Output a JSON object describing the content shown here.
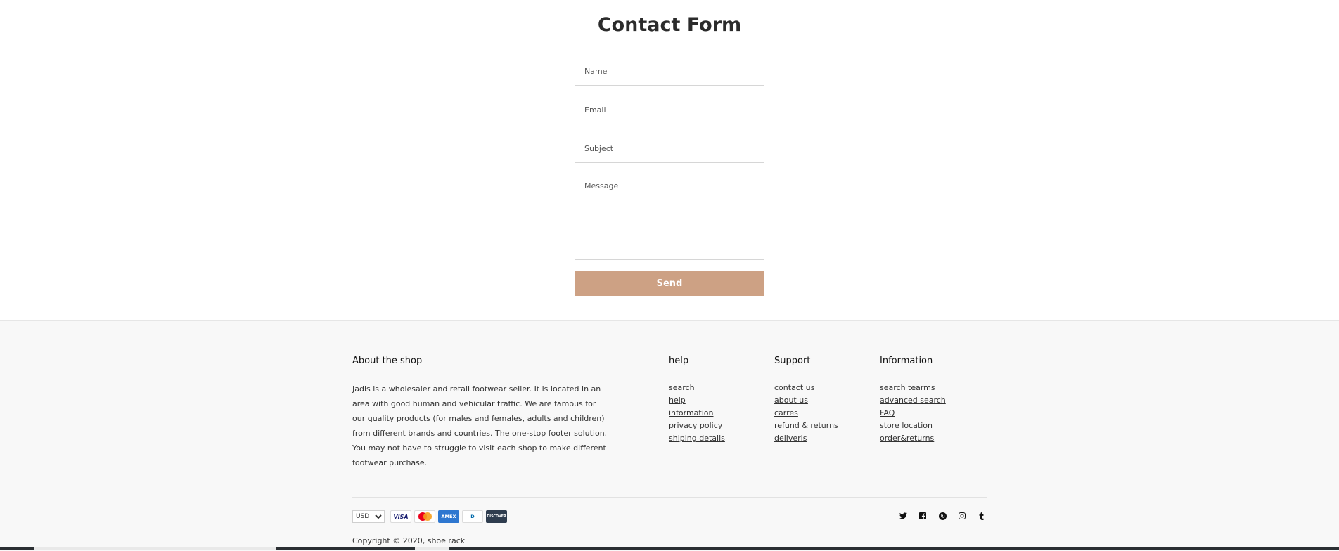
{
  "contact": {
    "title": "Contact Form",
    "name_placeholder": "Name",
    "email_placeholder": "Email",
    "subject_placeholder": "Subject",
    "message_placeholder": "Message",
    "send_label": "Send",
    "send_color": "#cda184"
  },
  "footer": {
    "about": {
      "title": "About the shop",
      "text": "Jadis is a wholesaler and retail footwear seller. It is located in an area with good human and vehicular traffic. We are famous for our quality products (for males and females, adults and children) from different brands and countries. The one-stop footer solution. You may not have to struggle to visit each shop to make different footwear purchase."
    },
    "help": {
      "title": "help",
      "links": [
        "search",
        "help",
        "information",
        "privacy policy",
        "shiping details"
      ]
    },
    "support": {
      "title": "Support",
      "links": [
        "contact us",
        "about us",
        "carres",
        "refund & returns",
        "deliveris"
      ]
    },
    "information": {
      "title": "Information",
      "links": [
        "search tearms",
        "advanced search",
        "FAQ",
        "store location",
        "order&returns"
      ]
    },
    "currency": {
      "selected": "USD"
    },
    "payments": {
      "visa": "VISA",
      "amex": "AMEX",
      "diners": "D",
      "discover": "DISCOVER"
    },
    "social_icons": [
      "twitter-icon",
      "facebook-icon",
      "pinterest-icon",
      "instagram-icon",
      "tumblr-icon"
    ],
    "copyright": "Copyright © 2020, shoe rack"
  }
}
